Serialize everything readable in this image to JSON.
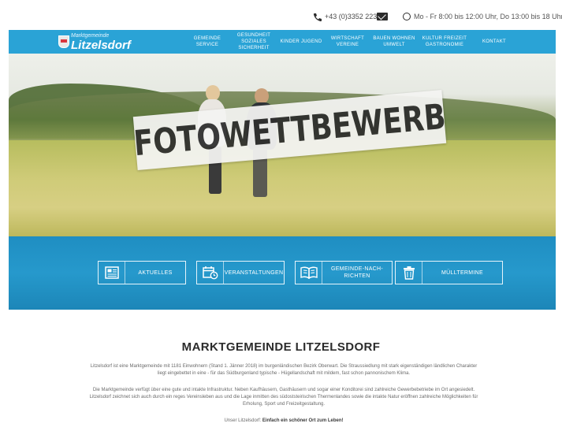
{
  "topbar": {
    "phone": "+43 (0)3352 2234",
    "hours": "Mo - Fr 8:00 bis 12:00 Uhr, Do 13:00 bis 18 Uhr"
  },
  "logo": {
    "small": "Marktgemeinde",
    "big": "Litzelsdorf"
  },
  "nav": [
    {
      "label": "GEMEINDE\nSERVICE"
    },
    {
      "label": "GESUNDHEIT\nSOZIALES\nSICHERHEIT"
    },
    {
      "label": "KINDER JUGEND"
    },
    {
      "label": "WIRTSCHAFT\nVEREINE"
    },
    {
      "label": "BAUEN WOHNEN\nUMWELT"
    },
    {
      "label": "KULTUR FREIZEIT\nGASTRONOMIE"
    },
    {
      "label": "KONTAKT"
    }
  ],
  "hero": {
    "banner": "FOTOWETTBEWERB"
  },
  "quicklinks": [
    {
      "label": "AKTUELLES",
      "icon": "newspaper-icon"
    },
    {
      "label": "VERANSTALTUNGEN",
      "icon": "calendar-clock-icon"
    },
    {
      "label": "GEMEINDE-NACH-\nRICHTEN",
      "icon": "open-book-icon"
    },
    {
      "label": "MÜLLTERMINE",
      "icon": "trash-can-icon"
    }
  ],
  "content": {
    "heading": "MARKTGEMEINDE LITZELSDORF",
    "para1": "Litzelsdorf ist eine Marktgemeinde mit 1181 Einwohnern (Stand 1. Jänner 2018) im burgenländischen Bezirk Oberwart. Die Straussiedlung mit stark eigenständigen ländlichen Charakter liegt eingebettet in eine - für das Südburgenland typische - Hügellandschaft mit mildem, fast schon pannonischem Klima.",
    "para2": "Die Marktgemeinde verfügt über eine gute und intakte Infrastruktur. Neben Kaufhäusern, Gasthäusern und sogar einer Konditorei sind zahlreiche Gewerbebetriebe im Ort angesiedelt. Litzelsdorf zeichnet sich auch durch ein reges Vereinsleben aus und die Lage inmitten des südoststeirischen Thermenlandes sowie die intakte Natur eröffnen zahlreiche Möglichkeiten für Erholung, Sport und Freizeitgestaltung.",
    "para3_prefix": "Unser Litzelsdorf:",
    "para3_bold": "Einfach ein schöner Ort zum Leben!"
  },
  "colors": {
    "nav_blue": "#2aa3d6",
    "band_blue": "#1f8ec2"
  }
}
